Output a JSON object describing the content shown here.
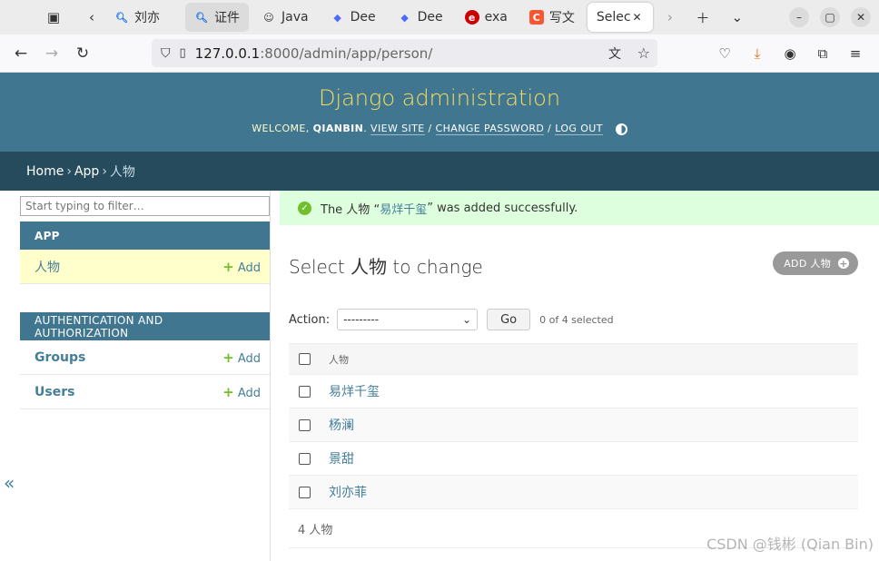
{
  "browser": {
    "tabs": [
      {
        "label": "刘亦",
        "icon": "search-icon",
        "style": "plain"
      },
      {
        "label": "证件",
        "icon": "search-icon",
        "style": "grey"
      },
      {
        "label": "Java",
        "icon": "user-avatar-icon",
        "style": "plain"
      },
      {
        "label": "Dee",
        "icon": "whale-icon",
        "style": "plain"
      },
      {
        "label": "Dee",
        "icon": "whale-icon",
        "style": "plain"
      },
      {
        "label": "exa",
        "icon": "ie-logo-icon",
        "style": "plain"
      },
      {
        "label": "写文",
        "icon": "csdn-c-icon",
        "style": "plain"
      },
      {
        "label": "Selec",
        "icon": "",
        "style": "active"
      }
    ],
    "url_host": "127.0.0.1",
    "url_path": ":8000/admin/app/person/"
  },
  "header": {
    "brand": "Django administration",
    "welcome": "WELCOME,",
    "user": "QIANBIN",
    "view_site": "VIEW SITE",
    "change_password": "CHANGE PASSWORD",
    "log_out": "LOG OUT"
  },
  "breadcrumbs": {
    "home": "Home",
    "app": "App",
    "current": "人物"
  },
  "sidebar": {
    "filter_placeholder": "Start typing to filter…",
    "app_caption": "APP",
    "app_items": [
      {
        "label": "人物",
        "add": "Add"
      }
    ],
    "auth_caption": "AUTHENTICATION AND AUTHORIZATION",
    "auth_items": [
      {
        "label": "Groups",
        "add": "Add"
      },
      {
        "label": "Users",
        "add": "Add"
      }
    ],
    "collapse": "«"
  },
  "message": {
    "before": "The 人物 “",
    "link": "易烊千玺",
    "after": "” was added successfully."
  },
  "content": {
    "title": "Select 人物 to change",
    "add_button": "ADD 人物",
    "action_label": "Action:",
    "action_value": "---------",
    "go": "Go",
    "selected": "0 of 4 selected",
    "column": "人物",
    "rows": [
      "易烊千玺",
      "杨澜",
      "景甜",
      "刘亦菲"
    ],
    "count": "4 人物"
  },
  "watermark": "CSDN @钱彬 (Qian Bin)",
  "colors": {
    "header": "#417690",
    "breadcrumbs": "#264b5d",
    "brand": "#f5dd5d",
    "success": "#ddffdd",
    "link": "#447e9b",
    "add_green": "#70bf2b"
  }
}
